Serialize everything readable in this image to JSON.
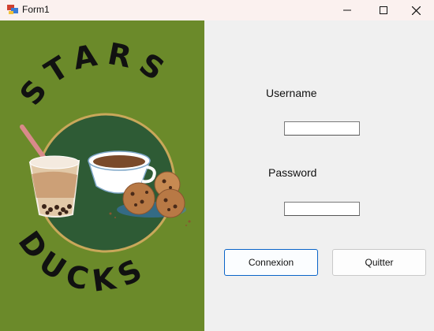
{
  "window": {
    "title": "Form1"
  },
  "logo": {
    "top_text": "STARS",
    "bottom_text": "DUCKS"
  },
  "form": {
    "username_label": "Username",
    "password_label": "Password",
    "username_value": "",
    "password_value": "",
    "connect_label": "Connexion",
    "quit_label": "Quitter"
  },
  "colors": {
    "panel_green": "#6b8a2a",
    "circle_green": "#2e5b35",
    "accent_blue": "#0a64c8"
  }
}
